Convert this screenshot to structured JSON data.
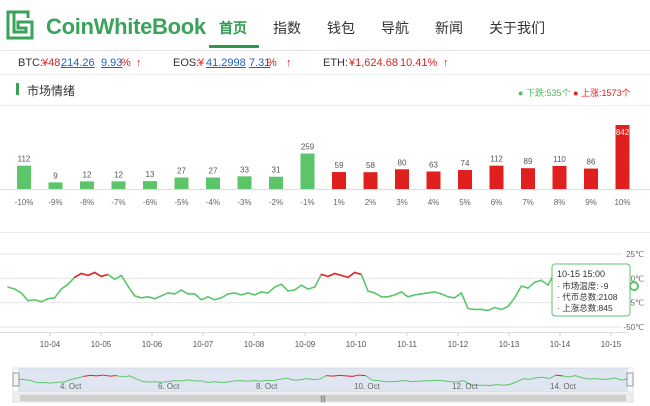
{
  "brand": {
    "name": "CoinWhiteBook"
  },
  "nav": {
    "items": [
      "首页",
      "指数",
      "钱包",
      "导航",
      "新闻",
      "关于我们"
    ],
    "active": 0
  },
  "ticker": {
    "btc": {
      "label": "BTC:",
      "price_prefix": "¥48,",
      "price_link": "214.26",
      "change_link": "9.93",
      "change_suffix": "%",
      "arrow": "↑"
    },
    "eos": {
      "label": "EOS:",
      "price_prefix": "¥",
      "price_link": "41.2998",
      "change_link": "7.31",
      "change_suffix": "%",
      "arrow": "↑"
    },
    "eth": {
      "label": "ETH:",
      "price": "¥1,624.68",
      "change": "10.41%",
      "arrow": "↑"
    }
  },
  "section": {
    "title": "市场情绪",
    "legend_down": "下跌:535个",
    "legend_up": "上涨:1573个"
  },
  "colors": {
    "up": "#e0201e",
    "down": "#5cc56a",
    "brand": "#3aa35a"
  },
  "chart_data": [
    {
      "type": "bar",
      "categories": [
        "-10%",
        "-9%",
        "-8%",
        "-7%",
        "-6%",
        "-5%",
        "-4%",
        "-3%",
        "-2%",
        "-1%",
        "1%",
        "2%",
        "3%",
        "4%",
        "5%",
        "6%",
        "7%",
        "8%",
        "9%",
        "10%"
      ],
      "values": [
        112,
        9,
        12,
        12,
        13,
        27,
        27,
        33,
        31,
        259,
        59,
        58,
        80,
        63,
        74,
        112,
        89,
        110,
        86,
        842
      ],
      "colors": [
        "down",
        "down",
        "down",
        "down",
        "down",
        "down",
        "down",
        "down",
        "down",
        "down",
        "up",
        "up",
        "up",
        "up",
        "up",
        "up",
        "up",
        "up",
        "up",
        "up"
      ],
      "ylim": [
        0,
        842
      ]
    },
    {
      "type": "line",
      "x_labels": [
        "10-04",
        "10-05",
        "10-06",
        "10-07",
        "10-08",
        "10-09",
        "10-10",
        "10-11",
        "10-12",
        "10-13",
        "10-14",
        "10-15"
      ],
      "y_ticks": [
        "25℃",
        "0℃",
        "-25℃",
        "-50℃"
      ],
      "ylim": [
        -50,
        25
      ],
      "values": [
        -9,
        -11,
        -15,
        -23,
        -22,
        -24,
        -21,
        -20,
        -11,
        -6,
        1,
        5,
        3,
        6,
        2,
        4,
        -1,
        3,
        -8,
        -18,
        -20,
        -19,
        -21,
        -18,
        -15,
        -16,
        -12,
        -16,
        -16,
        -22,
        -19,
        -22,
        -20,
        -16,
        -15,
        -17,
        -15,
        -17,
        -14,
        -15,
        -9,
        -6,
        -13,
        -12,
        -7,
        -11,
        -9,
        4,
        2,
        5,
        3,
        1,
        6,
        4,
        -13,
        -15,
        -19,
        -19,
        -17,
        -14,
        -19,
        -17,
        -16,
        -15,
        -14,
        -16,
        -19,
        -20,
        -15,
        -31,
        -32,
        -32,
        -33,
        -30,
        -32,
        -29,
        -20,
        -8,
        -10,
        -4,
        -2,
        -7,
        6,
        3,
        -1,
        4,
        -4,
        -9,
        -7,
        -10,
        -9,
        -5,
        -13,
        -8
      ],
      "up_threshold": 0,
      "tooltip": {
        "title": "10-15 15:00",
        "lines": [
          "· 市场温度: -9",
          "· 代币总数:2108",
          "· 上涨总数:845"
        ]
      },
      "navigator_labels": [
        "4. Oct",
        "6. Oct",
        "8. Oct",
        "10. Oct",
        "12. Oct",
        "14. Oct"
      ]
    }
  ]
}
